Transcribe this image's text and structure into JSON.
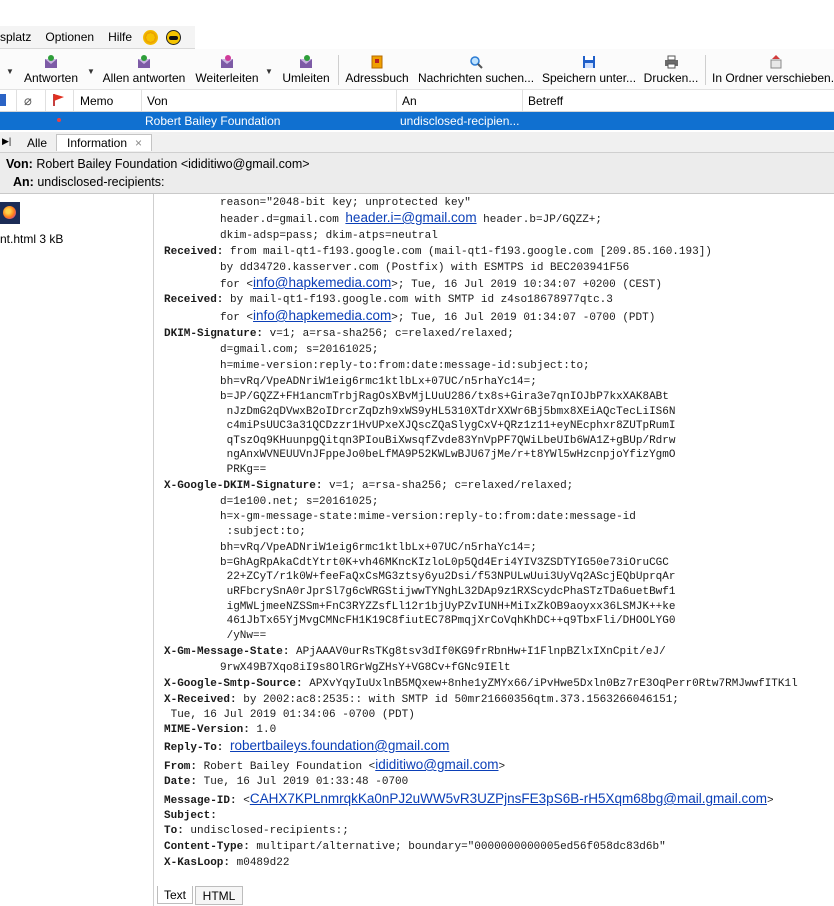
{
  "menu": {
    "items": [
      "splatz",
      "Optionen",
      "Hilfe"
    ]
  },
  "toolbar": {
    "reply": "Antworten",
    "reply_all": "Allen antworten",
    "forward": "Weiterleiten",
    "redirect": "Umleiten",
    "address_book": "Adressbuch",
    "search": "Nachrichten suchen...",
    "save": "Speichern unter...",
    "print": "Drucken...",
    "move": "In Ordner verschieben..."
  },
  "columns": {
    "memo": "Memo",
    "from": "Von",
    "to": "An",
    "subject": "Betreff"
  },
  "selected_row": {
    "from": "Robert Bailey Foundation",
    "to": "undisclosed-recipien..."
  },
  "tabs": {
    "all": "Alle",
    "info": "Information",
    "close": "×"
  },
  "header": {
    "from_label": "Von:",
    "from_value": "Robert Bailey Foundation <ididitiwo@gmail.com>",
    "to_label": "An:",
    "to_value": "undisclosed-recipients:"
  },
  "attachment": {
    "label": "nt.html 3 kB"
  },
  "source": {
    "l1": "reason=\"2048-bit key; unprotected key\"",
    "l2a": "header.d=gmail.com ",
    "l2link": "header.i=@gmail.com",
    "l2b": " header.b=JP/GQZZ+;",
    "l3": "dkim-adsp=pass; dkim-atps=neutral",
    "l4k": "Received:",
    "l4v": " from mail-qt1-f193.google.com (mail-qt1-f193.google.com [209.85.160.193])",
    "l5": "by dd34720.kasserver.com (Postfix) with ESMTPS id BEC203941F56",
    "l6a": "for <",
    "l6link": "info@hapkemedia.com",
    "l6b": ">; Tue, 16 Jul 2019 10:34:07 +0200 (CEST)",
    "l7k": "Received:",
    "l7v": " by mail-qt1-f193.google.com with SMTP id z4so18678977qtc.3",
    "l8a": "for <",
    "l8link": "info@hapkemedia.com",
    "l8b": ">; Tue, 16 Jul 2019 01:34:07 -0700 (PDT)",
    "l9k": "DKIM-Signature:",
    "l9v": " v=1; a=rsa-sha256; c=relaxed/relaxed;",
    "l10": "d=gmail.com; s=20161025;",
    "l11": "h=mime-version:reply-to:from:date:message-id:subject:to;",
    "l12": "bh=vRq/VpeADNriW1eig6rmc1ktlbLx+07UC/n5rhaYc14=;",
    "l13": "b=JP/GQZZ+FH1ancmTrbjRagOsXBvMjLUuU286/tx8s+Gira3e7qnIOJbP7kxXAK8ABt",
    "l14": " nJzDmG2qDVwxB2oIDrcrZqDzh9xWS9yHL5310XTdrXXWr6Bj5bmx8XEiAQcTecLiIS6N",
    "l15": " c4miPsUUC3a31QCDzzr1HvUPxeXJQscZQaSlygCxV+QRz1z11+eyNEcphxr8ZUTpRumI",
    "l16": " qTszOq9KHuunpgQitqn3PIouBiXwsqfZvde83YnVpPF7QWiLbeUIb6WA1Z+gBUp/Rdrw",
    "l17": " ngAnxWVNEUUVnJFppeJo0beLfMA9P52KWLwBJU67jMe/r+t8YWl5wHzcnpjoYfizYgmO",
    "l18": " PRKg==",
    "l19k": "X-Google-DKIM-Signature:",
    "l19v": " v=1; a=rsa-sha256; c=relaxed/relaxed;",
    "l20": "d=1e100.net; s=20161025;",
    "l21": "h=x-gm-message-state:mime-version:reply-to:from:date:message-id",
    "l22": " :subject:to;",
    "l23": "bh=vRq/VpeADNriW1eig6rmc1ktlbLx+07UC/n5rhaYc14=;",
    "l24": "b=GhAgRpAkaCdtYtrt0K+vh46MKncKIzloL0p5Qd4Eri4YIV3ZSDTYIG50e73iOruCGC",
    "l25": " 22+ZCyT/r1k0W+feeFaQxCsMG3ztsy6yu2Dsi/f53NPULwUui3UyVq2AScjEQbUprqAr",
    "l26": " uRFbcrySnA0rJprSl7g6cWRGStijwwTYNghL32DAp9z1RXScydcPhaSTzTDa6uetBwf1",
    "l27": " igMWLjmeeNZSSm+FnC3RYZZsfLl12r1bjUyPZvIUNH+MiIxZkOB9aoyxx36LSMJK++ke",
    "l28": " 461JbTx65YjMvgCMNcFH1K19C8fiutEC78PmqjXrCoVqhKhDC++q9TbxFli/DHOOLYG0",
    "l29": " /yNw==",
    "l30k": "X-Gm-Message-State:",
    "l30v": " APjAAAV0urRsTKg8tsv3dIf0KG9frRbnHw+I1FlnpBZlxIXnCpit/eJ/",
    "l31": "9rwX49B7Xqo8iI9s8OlRGrWgZHsY+VG8Cv+fGNc9IElt",
    "l32k": "X-Google-Smtp-Source:",
    "l32v": " APXvYqyIuUxlnB5MQxew+8nhe1yZMYx66/iPvHwe5Dxln0Bz7rE3OqPerr0Rtw7RMJwwfITK1l",
    "l33k": "X-Received:",
    "l33v": " by 2002:ac8:2535:: with SMTP id 50mr21660356qtm.373.1563266046151;",
    "l34": " Tue, 16 Jul 2019 01:34:06 -0700 (PDT)",
    "l35k": "MIME-Version:",
    "l35v": " 1.0",
    "l36k": "Reply-To:",
    "l36link": "robertbaileys.foundation@gmail.com",
    "l37k": "From:",
    "l37v": " Robert Bailey Foundation <",
    "l37link": "ididitiwo@gmail.com",
    "l37e": ">",
    "l38k": "Date:",
    "l38v": " Tue, 16 Jul 2019 01:33:48 -0700",
    "l39k": "Message-ID:",
    "l39a": " <",
    "l39link": "CAHX7KPLnmrqkKa0nPJ2uWW5vR3UZPjnsFE3pS6B-rH5Xqm68bg@mail.gmail.com",
    "l39e": ">",
    "l40k": "Subject:",
    "l41k": "To:",
    "l41v": " undisclosed-recipients:;",
    "l42k": "Content-Type:",
    "l42v": " multipart/alternative; boundary=\"0000000000005ed56f058dc83d6b\"",
    "l43k": "X-KasLoop:",
    "l43v": " m0489d22"
  },
  "bottom_tabs": {
    "text": "Text",
    "html": "HTML"
  }
}
